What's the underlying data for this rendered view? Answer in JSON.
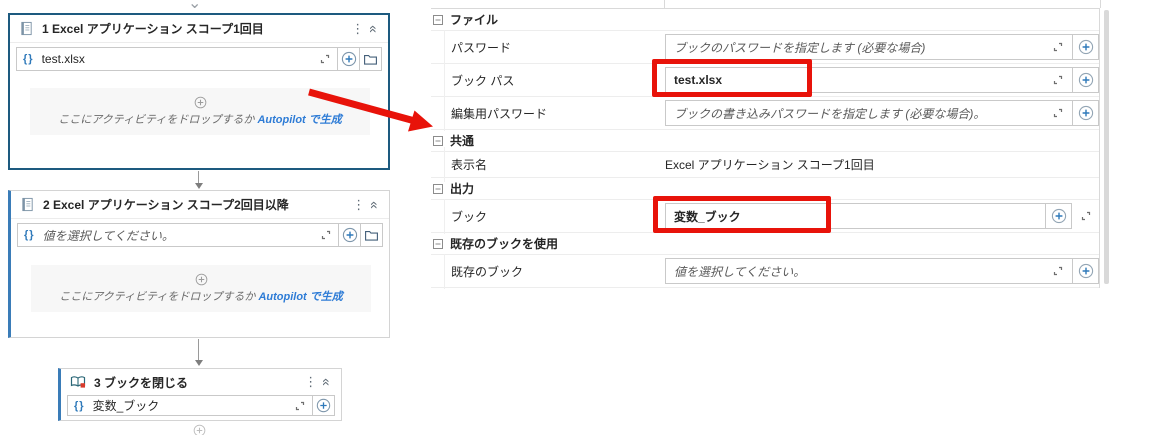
{
  "icons": {
    "kebab": "⋮",
    "collapse": "«",
    "chevron_down": "⌄"
  },
  "colors": {
    "selected_border": "#1d5a7f",
    "accent_bar": "#3a7cb8",
    "annotation_red": "#e8130a",
    "link_blue": "#2e7cd6",
    "plus_blue": "#2e79ba"
  },
  "workflow": {
    "cards": [
      {
        "title": "1 Excel アプリケーション スコープ1回目",
        "braces": "{}",
        "input_value": "test.xlsx",
        "drop_text": "ここにアクティビティをドロップするか",
        "drop_link": "Autopilot で生成"
      },
      {
        "title": "2 Excel アプリケーション スコープ2回目以降",
        "braces": "{}",
        "input_value": "値を選択してください。",
        "drop_text": "ここにアクティビティをドロップするか",
        "drop_link": "Autopilot で生成"
      },
      {
        "title": "3 ブックを閉じる",
        "braces": "{}",
        "input_value": "変数_ブック"
      }
    ]
  },
  "properties": {
    "sections": [
      {
        "label": "ファイル",
        "rows": [
          {
            "label": "パスワード",
            "value": "ブックのパスワードを指定します (必要な場合)"
          },
          {
            "label": "ブック パス",
            "value": "test.xlsx"
          },
          {
            "label": "編集用パスワード",
            "value": "ブックの書き込みパスワードを指定します (必要な場合)。"
          }
        ]
      },
      {
        "label": "共通",
        "rows": [
          {
            "label": "表示名",
            "value": "Excel アプリケーション スコープ1回目"
          }
        ]
      },
      {
        "label": "出力",
        "rows": [
          {
            "label": "ブック",
            "value": "変数_ブック"
          }
        ]
      },
      {
        "label": "既存のブックを使用",
        "rows": [
          {
            "label": "既存のブック",
            "value": "値を選択してください。"
          }
        ]
      }
    ]
  }
}
